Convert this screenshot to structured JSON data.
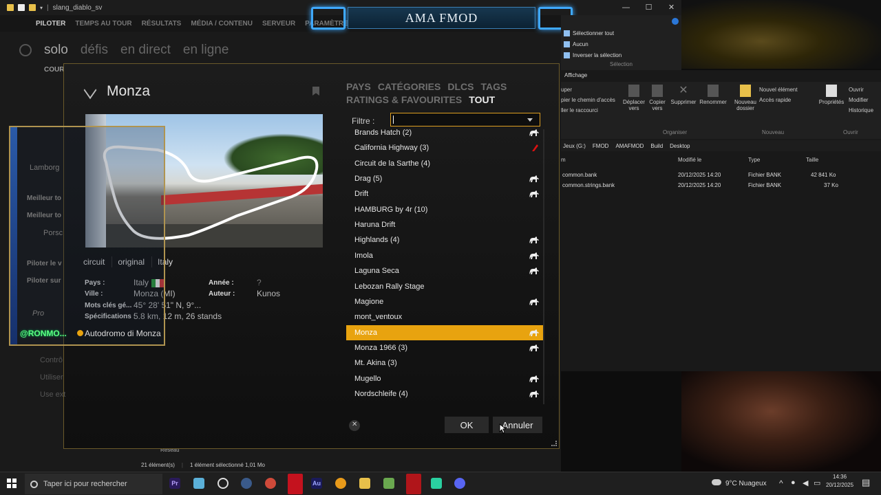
{
  "window": {
    "title": "slang_diablo_sv",
    "controls": [
      "—",
      "☐",
      "✕"
    ]
  },
  "stream": {
    "title": "AMA FMOD"
  },
  "game": {
    "nav": [
      "PILOTER",
      "TEMPS AU TOUR",
      "RÉSULTATS",
      "MÉDIA / CONTENU",
      "SERVEUR",
      "PARAMÈTRES"
    ],
    "sub": [
      "solo",
      "défis",
      "en direct",
      "en ligne"
    ],
    "cour": "COUR",
    "side_items": [
      "Lamborg",
      "Meilleur to",
      "Meilleur to",
      "Porsc",
      "Piloter le v",
      "Piloter sur",
      "Pro",
      "Contrô",
      "Utiliser",
      "Use ext"
    ]
  },
  "overlay": {
    "name": "@RONMO...",
    "sub": "Autodromo di Monza"
  },
  "explorer": {
    "select": [
      "Sélectionner tout",
      "Aucun",
      "Inverser la sélection"
    ],
    "select_group": "Sélection",
    "tab": "Affichage",
    "clipboard": [
      "uper",
      "pier le chemin d'accès",
      "ller le raccourci"
    ],
    "organize_buttons": [
      "Déplacer vers",
      "Copier vers",
      "Supprimer",
      "Renommer"
    ],
    "new_buttons": [
      "Nouveau dossier",
      "Nouvel élément",
      "Accès rapide"
    ],
    "open_buttons": [
      "Propriétés",
      "Ouvrir",
      "Modifier",
      "Historique"
    ],
    "groups": [
      "Organiser",
      "Nouveau",
      "Ouvrir"
    ],
    "path": [
      "Jeux (G:)",
      "FMOD",
      "AMAFMOD",
      "Build",
      "Desktop"
    ],
    "headers": [
      "m",
      "Modifié le",
      "Type",
      "Taille"
    ],
    "files": [
      {
        "name": "common.bank",
        "date": "20/12/2025 14:20",
        "type": "Fichier BANK",
        "size": "42 841 Ko"
      },
      {
        "name": "common.strings.bank",
        "date": "20/12/2025 14:20",
        "type": "Fichier BANK",
        "size": "37 Ko"
      }
    ],
    "nav_item": "Réseau",
    "status": [
      "21 élément(s)",
      "1 élément sélectionné  1,01 Mo"
    ]
  },
  "dialog": {
    "title": "Monza",
    "tags": [
      "circuit",
      "original",
      "Italy"
    ],
    "info": {
      "pays_label": "Pays :",
      "pays": "Italy",
      "annee_label": "Année :",
      "annee": "?",
      "ville_label": "Ville :",
      "ville": "Monza (MI)",
      "auteur_label": "Auteur :",
      "auteur": "Kunos",
      "mots_label": "Mots clés gé...",
      "mots": "45° 28' 51\" N, 9°...",
      "spec_label": "Spécifications :",
      "spec": "5.8 km, 12 m, 26 stands"
    },
    "categories_row1": [
      "PAYS",
      "CATÉGORIES",
      "DLCS",
      "TAGS"
    ],
    "categories_row2": [
      "RATINGS & FAVOURITES",
      "TOUT"
    ],
    "filter_label": "Filtre :",
    "filter_value": "",
    "list": [
      {
        "name": "Brands Hatch (2)",
        "icon": "horse"
      },
      {
        "name": "California Highway (3)",
        "icon": "red"
      },
      {
        "name": "Circuit de la Sarthe (4)",
        "icon": ""
      },
      {
        "name": "Drag (5)",
        "icon": "horse"
      },
      {
        "name": "Drift",
        "icon": "horse"
      },
      {
        "name": "HAMBURG by 4r (10)",
        "icon": ""
      },
      {
        "name": "Haruna Drift",
        "icon": ""
      },
      {
        "name": "Highlands (4)",
        "icon": "horse"
      },
      {
        "name": "Imola",
        "icon": "horse"
      },
      {
        "name": "Laguna Seca",
        "icon": "horse"
      },
      {
        "name": "Lebozan Rally Stage",
        "icon": ""
      },
      {
        "name": "Magione",
        "icon": "horse"
      },
      {
        "name": "mont_ventoux",
        "icon": ""
      },
      {
        "name": "Monza",
        "icon": "horse",
        "selected": true
      },
      {
        "name": "Monza 1966 (3)",
        "icon": "horse"
      },
      {
        "name": "Mt. Akina (3)",
        "icon": ""
      },
      {
        "name": "Mugello",
        "icon": "horse"
      },
      {
        "name": "Nordschleife (4)",
        "icon": "horse"
      }
    ],
    "ok": "OK",
    "cancel": "Annuler"
  },
  "taskbar": {
    "search_placeholder": "Taper ici pour rechercher",
    "weather": "9°C  Nuageux",
    "time": "14:36",
    "date": "20/12/2025",
    "apps": [
      "Pr",
      "Au"
    ]
  }
}
